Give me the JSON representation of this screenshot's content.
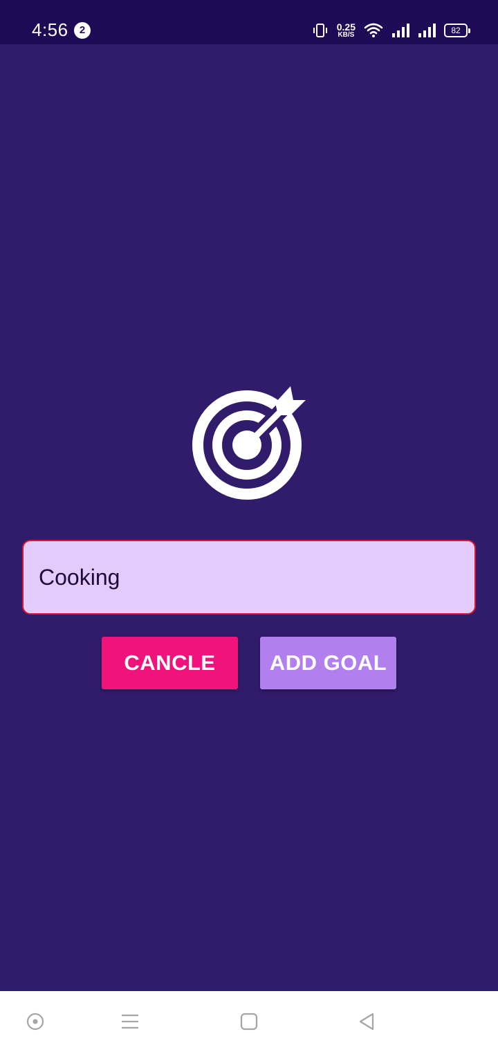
{
  "status_bar": {
    "time": "4:56",
    "notification_count": "2",
    "net_speed_value": "0.25",
    "net_speed_unit": "KB/S",
    "battery_level": "82",
    "icons": [
      "vibrate-icon",
      "wifi-icon",
      "signal-icon",
      "signal-icon",
      "battery-icon"
    ]
  },
  "goal_form": {
    "icon": "target-arrow-icon",
    "input_value": "Cooking",
    "cancel_label": "CANCLE",
    "add_label": "ADD GOAL"
  },
  "nav_bar": {
    "icons": [
      "assistant-icon",
      "recents-menu-icon",
      "home-icon",
      "back-icon"
    ]
  },
  "colors": {
    "background": "#311b6b",
    "status_bar": "#1f0a56",
    "input_background": "#e3ccfd",
    "input_border": "#e0142c",
    "cancel_button": "#f2127c",
    "add_button": "#b180ee"
  }
}
